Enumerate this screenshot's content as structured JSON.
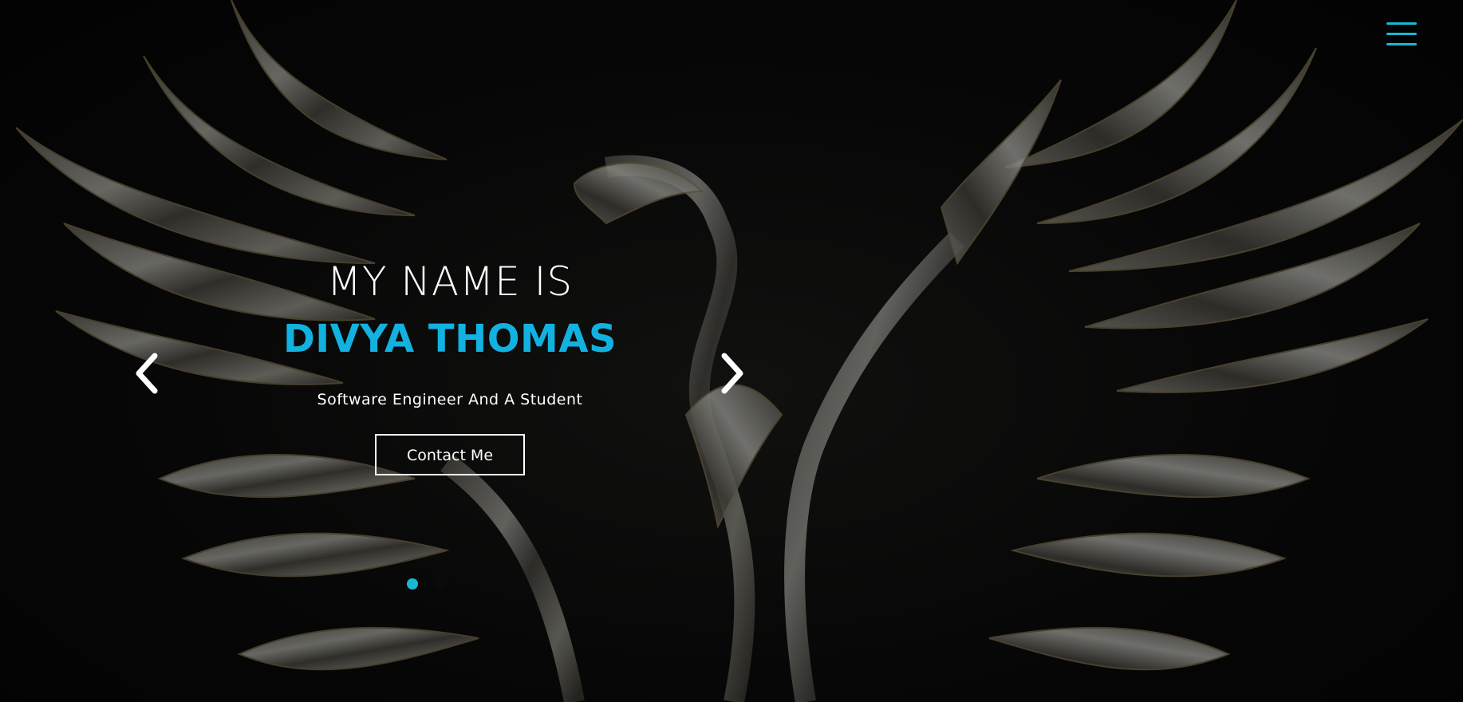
{
  "nav": {
    "menu_icon": "hamburger-menu-icon",
    "accent": "#19b9d2"
  },
  "hero": {
    "intro": "MY NAME IS",
    "name": "DIVYA THOMAS",
    "tagline": "Software Engineer And A Student",
    "cta_label": "Contact Me",
    "name_color": "#12b2e0",
    "background_image": "phoenix-emblem"
  },
  "carousel": {
    "prev_icon": "chevron-left-icon",
    "next_icon": "chevron-right-icon",
    "indicators": [
      {
        "state": "active"
      },
      {
        "state": "inactive"
      }
    ]
  }
}
